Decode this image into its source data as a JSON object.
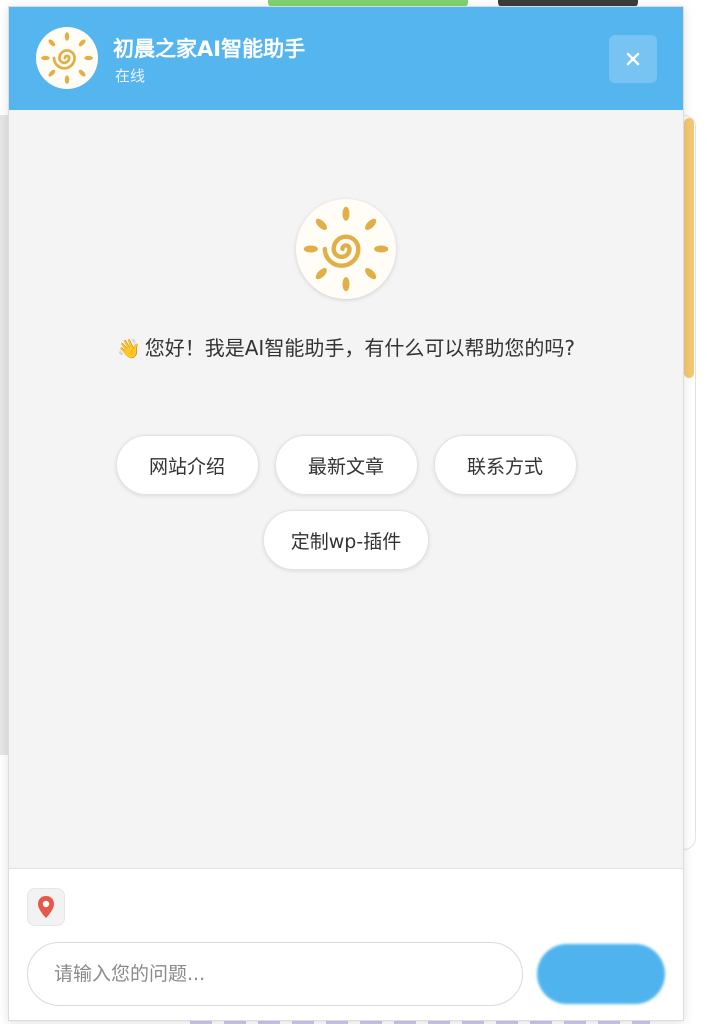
{
  "header": {
    "title": "初晨之家AI智能助手",
    "status": "在线",
    "close_icon": "close-icon"
  },
  "welcome": {
    "wave_emoji": "👋",
    "message": "您好！我是AI智能助手，有什么可以帮助您的吗?"
  },
  "quick_replies": [
    {
      "label": "网站介绍"
    },
    {
      "label": "最新文章"
    },
    {
      "label": "联系方式"
    },
    {
      "label": "定制wp-插件"
    }
  ],
  "footer": {
    "location_icon": "location-pin-icon",
    "input_placeholder": "请输入您的问题..."
  },
  "colors": {
    "header_bg": "#55b5ef",
    "body_bg": "#f4f4f4",
    "avatar_sun": "#e2ae48",
    "send_button": "#4fb4ee"
  }
}
